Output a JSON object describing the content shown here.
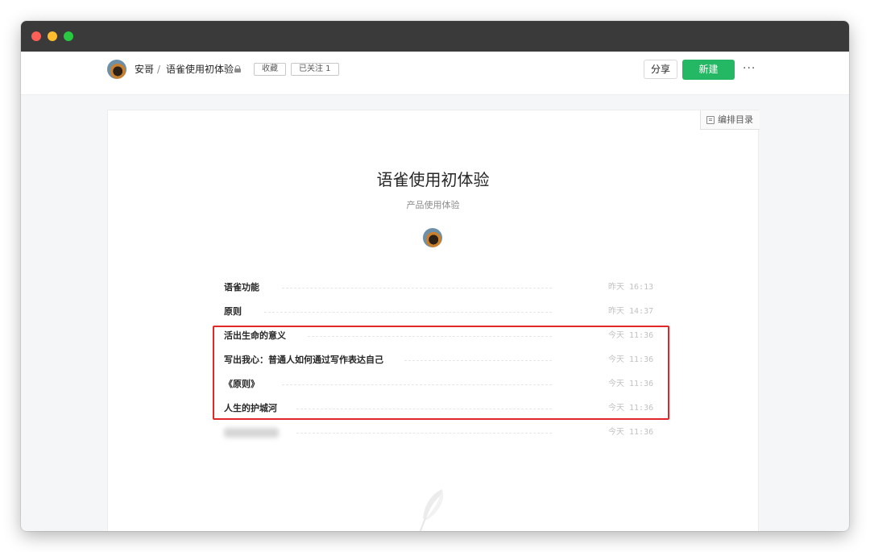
{
  "header": {
    "user_name": "安哥",
    "separator": "/",
    "book_name": "语雀使用初体验",
    "collect_label": "收藏",
    "follow_label": "已关注 1",
    "share_label": "分享",
    "new_label": "新建",
    "more_label": "···"
  },
  "book": {
    "edit_toc_label": "编排目录",
    "title": "语雀使用初体验",
    "subtitle": "产品使用体验"
  },
  "toc": [
    {
      "title": "语雀功能",
      "time": "昨天 16:13"
    },
    {
      "title": "原则",
      "time": "昨天 14:37"
    },
    {
      "title": "活出生命的意义",
      "time": "今天 11:36"
    },
    {
      "title": "写出我心：普通人如何通过写作表达自己",
      "time": "今天 11:36"
    },
    {
      "title": "《原则》",
      "time": "今天 11:36"
    },
    {
      "title": "人生的护城河",
      "time": "今天 11:36"
    },
    {
      "title": "",
      "time": "今天 11:36"
    }
  ],
  "colors": {
    "primary_green": "#25b864",
    "highlight_red": "#e32626",
    "titlebar": "#3a3a3a"
  }
}
